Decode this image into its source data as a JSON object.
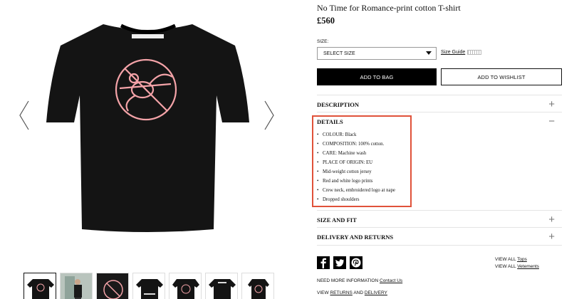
{
  "product": {
    "title": "No Time for Romance-print cotton T-shirt",
    "price": "£560"
  },
  "size": {
    "label": "SIZE:",
    "selected": "SELECT SIZE",
    "guide": "Size Guide"
  },
  "buttons": {
    "add_to_bag": "ADD TO BAG",
    "add_to_wishlist": "ADD TO WISHLIST"
  },
  "sections": {
    "description": {
      "title": "DESCRIPTION",
      "icon": "+"
    },
    "details": {
      "title": "DETAILS",
      "icon": "−",
      "items": [
        "COLOUR: Black",
        "COMPOSITION: 100% cotton.",
        "CARE: Machine wash",
        "PLACE OF ORIGIN: EU",
        "Mid-weight cotton jersey",
        "Red and white logo prints",
        "Crew neck, embroidered logo at nape",
        "Dropped shoulders"
      ]
    },
    "size_fit": {
      "title": "SIZE AND FIT",
      "icon": "+"
    },
    "delivery": {
      "title": "DELIVERY AND RETURNS",
      "icon": "+"
    }
  },
  "social": [
    "facebook-icon",
    "twitter-icon",
    "pinterest-icon"
  ],
  "view_all": {
    "prefix": "VIEW ALL",
    "tops": "Tops",
    "vetements": "Vetements"
  },
  "footer": {
    "need_more": "NEED MORE INFORMATION",
    "contact": "Contact Us",
    "view": "VIEW",
    "returns": "RETURNS",
    "and": "AND",
    "delivery": "DELIVERY"
  },
  "colors": {
    "highlight": "#e0523a",
    "neon_pink": "#f4a3a8",
    "shirt": "#111111"
  },
  "gallery": {
    "thumbnail_count": 7,
    "active_thumbnail": 1
  }
}
